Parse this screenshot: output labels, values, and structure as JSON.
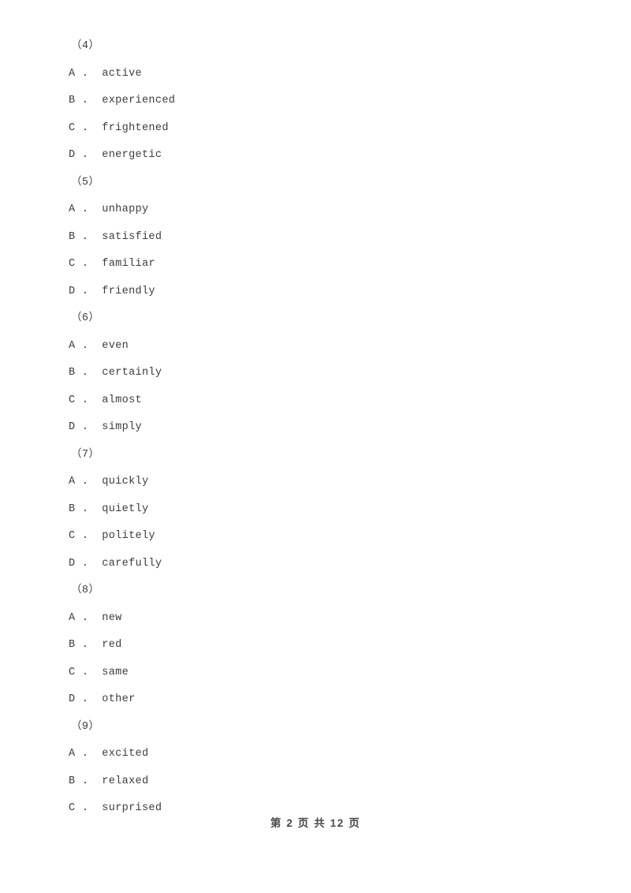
{
  "document": {
    "type": "exam-paper",
    "background_color": "#ffffff",
    "text_color": "#3d3d3d"
  },
  "questions": [
    {
      "number": "（4）",
      "options": [
        {
          "letter": "A",
          "separator": ".",
          "text": "active"
        },
        {
          "letter": "B",
          "separator": ".",
          "text": "experienced"
        },
        {
          "letter": "C",
          "separator": ".",
          "text": "frightened"
        },
        {
          "letter": "D",
          "separator": ".",
          "text": "energetic"
        }
      ]
    },
    {
      "number": "（5）",
      "options": [
        {
          "letter": "A",
          "separator": ".",
          "text": "unhappy"
        },
        {
          "letter": "B",
          "separator": ".",
          "text": "satisfied"
        },
        {
          "letter": "C",
          "separator": ".",
          "text": "familiar"
        },
        {
          "letter": "D",
          "separator": ".",
          "text": "friendly"
        }
      ]
    },
    {
      "number": "（6）",
      "options": [
        {
          "letter": "A",
          "separator": ".",
          "text": "even"
        },
        {
          "letter": "B",
          "separator": ".",
          "text": "certainly"
        },
        {
          "letter": "C",
          "separator": ".",
          "text": "almost"
        },
        {
          "letter": "D",
          "separator": ".",
          "text": "simply"
        }
      ]
    },
    {
      "number": "（7）",
      "options": [
        {
          "letter": "A",
          "separator": ".",
          "text": "quickly"
        },
        {
          "letter": "B",
          "separator": ".",
          "text": "quietly"
        },
        {
          "letter": "C",
          "separator": ".",
          "text": "politely"
        },
        {
          "letter": "D",
          "separator": ".",
          "text": "carefully"
        }
      ]
    },
    {
      "number": "（8）",
      "options": [
        {
          "letter": "A",
          "separator": ".",
          "text": "new"
        },
        {
          "letter": "B",
          "separator": ".",
          "text": "red"
        },
        {
          "letter": "C",
          "separator": ".",
          "text": "same"
        },
        {
          "letter": "D",
          "separator": ".",
          "text": "other"
        }
      ]
    },
    {
      "number": "（9）",
      "options": [
        {
          "letter": "A",
          "separator": ".",
          "text": "excited"
        },
        {
          "letter": "B",
          "separator": ".",
          "text": "relaxed"
        },
        {
          "letter": "C",
          "separator": ".",
          "text": "surprised"
        }
      ]
    }
  ],
  "footer": {
    "text": "第 2 页 共 12 页",
    "current_page": "2",
    "total_pages": "12"
  }
}
